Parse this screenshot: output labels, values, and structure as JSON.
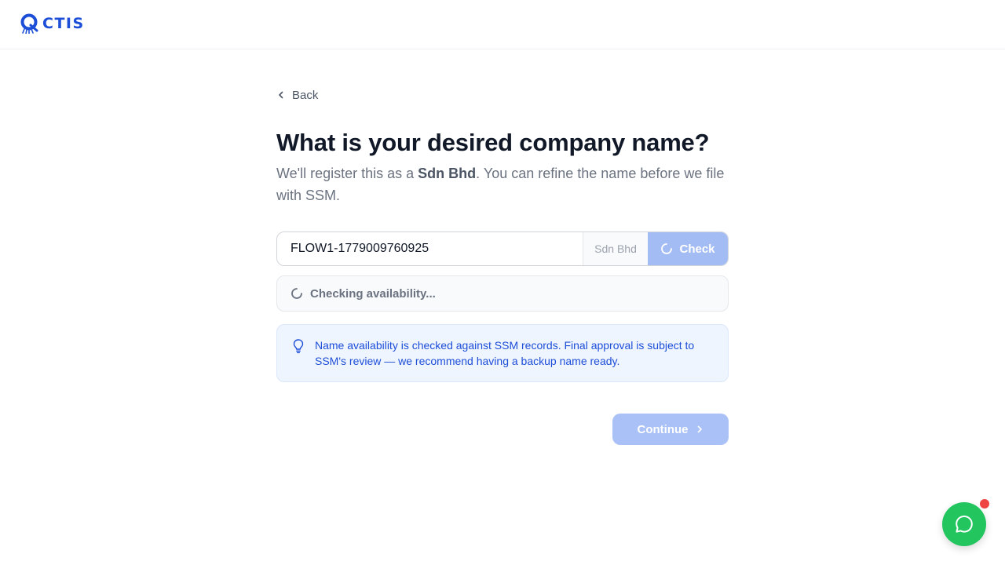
{
  "header": {
    "logo_text": "CTIS"
  },
  "nav": {
    "back_label": "Back"
  },
  "page": {
    "title": "What is your desired company name?",
    "subtitle_before": "We'll register this as a ",
    "subtitle_bold": "Sdn Bhd",
    "subtitle_after": ". You can refine the name before we file with SSM."
  },
  "name_field": {
    "value": "FLOW1-1779009760925",
    "suffix": "Sdn Bhd",
    "check_label": "Check"
  },
  "status": {
    "text": "Checking availability..."
  },
  "info": {
    "text": "Name availability is checked against SSM records. Final approval is subject to SSM's review — we recommend having a backup name ready."
  },
  "actions": {
    "continue_label": "Continue"
  },
  "colors": {
    "brand": "#1d4ed8",
    "check_disabled": "#a4bcf4",
    "continue_disabled": "#a9c1f6",
    "chat": "#22c55e",
    "notification": "#ef4444"
  },
  "icons": {
    "logo": "octis-logo-icon",
    "back": "chevron-left-icon",
    "check_spinner": "spinner-icon",
    "status_spinner": "spinner-icon",
    "info": "lightbulb-icon",
    "continue": "chevron-right-icon",
    "chat": "chat-bubble-icon"
  }
}
